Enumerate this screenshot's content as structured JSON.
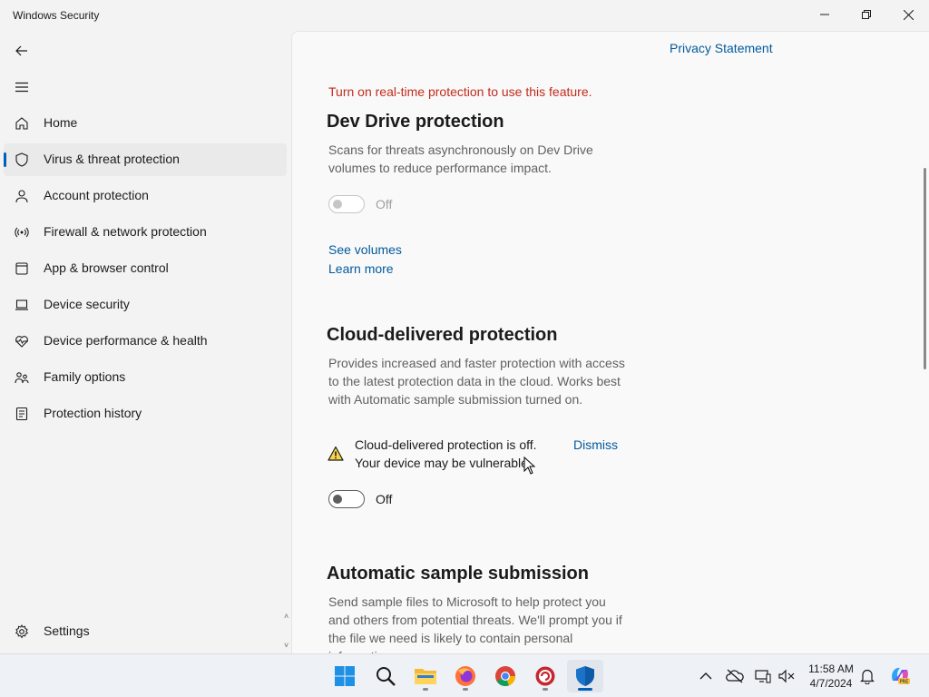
{
  "window": {
    "title": "Windows Security",
    "controls": [
      "minimize",
      "restore",
      "close"
    ]
  },
  "sidebar": {
    "back_icon": "back-arrow-icon",
    "menu_icon": "hamburger-icon",
    "items": [
      {
        "label": "Home",
        "icon": "home-icon",
        "selected": false
      },
      {
        "label": "Virus & threat protection",
        "icon": "shield-icon",
        "selected": true
      },
      {
        "label": "Account protection",
        "icon": "person-icon",
        "selected": false
      },
      {
        "label": "Firewall & network protection",
        "icon": "wireless-icon",
        "selected": false
      },
      {
        "label": "App & browser control",
        "icon": "app-window-icon",
        "selected": false
      },
      {
        "label": "Device security",
        "icon": "laptop-icon",
        "selected": false
      },
      {
        "label": "Device performance & health",
        "icon": "heart-pulse-icon",
        "selected": false
      },
      {
        "label": "Family options",
        "icon": "family-icon",
        "selected": false
      },
      {
        "label": "Protection history",
        "icon": "history-icon",
        "selected": false
      }
    ],
    "settings": {
      "label": "Settings",
      "icon": "gear-icon"
    }
  },
  "main": {
    "privacy_link": "Privacy Statement",
    "realtime_warning": "Turn on real-time protection to use this feature.",
    "dev_drive": {
      "title": "Dev Drive protection",
      "description": "Scans for threats asynchronously on Dev Drive volumes to reduce performance impact.",
      "toggle_state": "Off",
      "toggle_on": false,
      "toggle_disabled": true,
      "links": [
        "See volumes",
        "Learn more"
      ]
    },
    "cloud": {
      "title": "Cloud-delivered protection",
      "description": "Provides increased and faster protection with access to the latest protection data in the cloud. Works best with Automatic sample submission turned on.",
      "alert_line1": "Cloud-delivered protection is off.",
      "alert_line2": "Your device may be vulnerable.",
      "dismiss": "Dismiss",
      "toggle_state": "Off",
      "toggle_on": false
    },
    "sample": {
      "title": "Automatic sample submission",
      "description": "Send sample files to Microsoft to help protect you and others from potential threats. We'll prompt you if the file we need is likely to contain personal information."
    }
  },
  "taskbar": {
    "apps": [
      "start-icon",
      "search-icon",
      "file-explorer-icon",
      "firefox-icon",
      "chrome-icon",
      "app-icon",
      "windows-security-icon"
    ],
    "active_app": "windows-security-icon",
    "tray": [
      "chevron-up-icon",
      "onedrive-icon",
      "network-icon",
      "volume-mute-icon",
      "notification-bell-icon",
      "copilot-icon"
    ],
    "time": "11:58 AM",
    "date": "4/7/2024"
  },
  "colors": {
    "accent": "#005fb8",
    "link": "#005a9e",
    "warning": "#c42b1c"
  }
}
